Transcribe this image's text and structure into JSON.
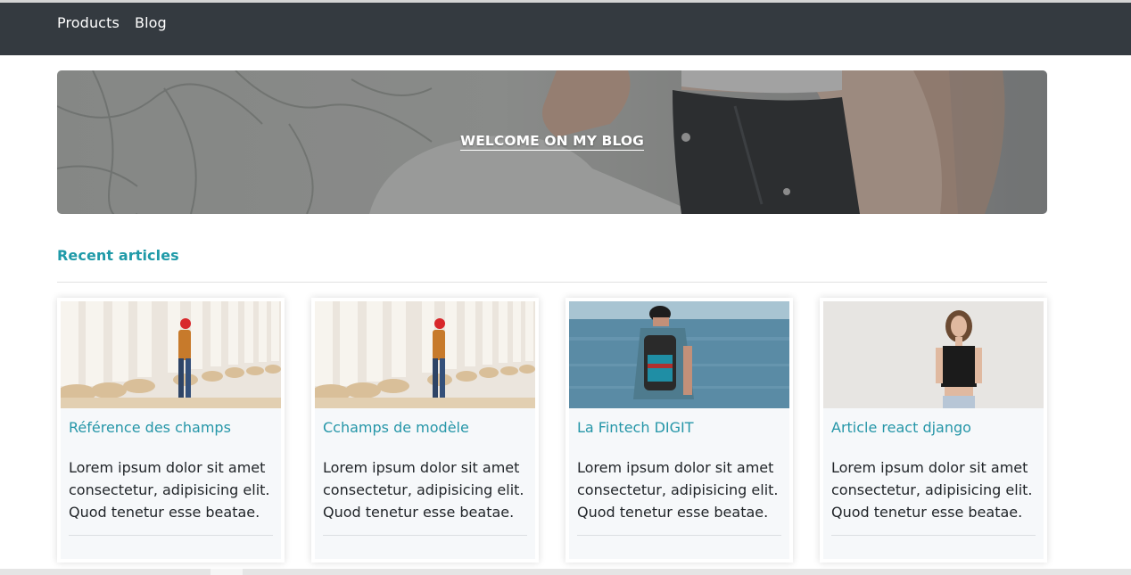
{
  "nav": {
    "items": [
      {
        "label": "Products"
      },
      {
        "label": "Blog"
      }
    ]
  },
  "hero": {
    "title": "WELCOME ON MY BLOG"
  },
  "section": {
    "title": "Recent articles"
  },
  "articles": [
    {
      "title": "Référence des champs",
      "excerpt": "Lorem ipsum dolor sit amet consectetur, adipisicing elit. Quod tenetur esse beatae.",
      "image_icon": "man-columns-photo"
    },
    {
      "title": "Cchamps de modèle",
      "excerpt": "Lorem ipsum dolor sit amet consectetur, adipisicing elit. Quod tenetur esse beatae.",
      "image_icon": "man-columns-photo"
    },
    {
      "title": "La Fintech DIGIT",
      "excerpt": "Lorem ipsum dolor sit amet consectetur, adipisicing elit. Quod tenetur esse beatae.",
      "image_icon": "backpacker-sea-photo"
    },
    {
      "title": "Article react django",
      "excerpt": "Lorem ipsum dolor sit amet consectetur, adipisicing elit. Quod tenetur esse beatae.",
      "image_icon": "woman-portrait-photo"
    }
  ],
  "colors": {
    "navbar": "#343a40",
    "accent": "#1f9aa8",
    "card_bg": "#f6f8fa"
  }
}
